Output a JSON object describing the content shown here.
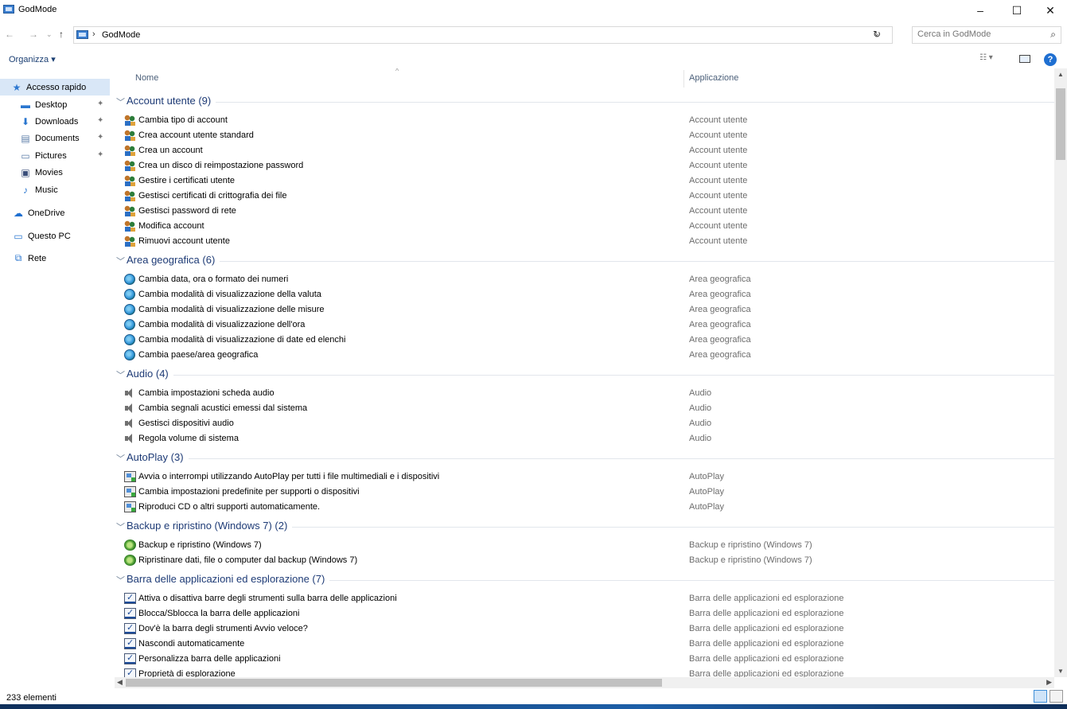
{
  "window": {
    "title": "GodMode",
    "controls": {
      "minimize": "–",
      "maximize": "☐",
      "close": "✕"
    }
  },
  "address": {
    "separator": "›",
    "crumb": "GodMode",
    "search_placeholder": "Cerca in GodMode"
  },
  "toolbar": {
    "organize_label": "Organizza ▾",
    "view_label": "☷ ▾",
    "help_label": "?"
  },
  "nav": {
    "items": [
      {
        "label": "Accesso rapido",
        "icon": "star-icon",
        "selected": true
      },
      {
        "label": "Desktop",
        "icon": "desktop-icon",
        "pinned": true
      },
      {
        "label": "Downloads",
        "icon": "download-icon",
        "pinned": true
      },
      {
        "label": "Documents",
        "icon": "document-icon",
        "pinned": true
      },
      {
        "label": "Pictures",
        "icon": "pictures-icon",
        "pinned": true
      },
      {
        "label": "Movies",
        "icon": "movies-icon"
      },
      {
        "label": "Music",
        "icon": "music-icon"
      },
      {
        "label": "OneDrive",
        "icon": "cloud-icon"
      },
      {
        "label": "Questo PC",
        "icon": "computer-icon"
      },
      {
        "label": "Rete",
        "icon": "network-icon"
      }
    ]
  },
  "columns": {
    "name": "Nome",
    "app": "Applicazione"
  },
  "groups": [
    {
      "title": "Account utente (9)",
      "app": "Account utente",
      "icon": "users",
      "items": [
        "Cambia tipo di account",
        "Crea account utente standard",
        "Crea un account",
        "Crea un disco di reimpostazione password",
        "Gestire i certificati utente",
        "Gestisci certificati di crittografia dei file",
        "Gestisci password di rete",
        "Modifica account",
        "Rimuovi account utente"
      ]
    },
    {
      "title": "Area geografica (6)",
      "app": "Area geografica",
      "icon": "globe",
      "items": [
        "Cambia data, ora o formato dei numeri",
        "Cambia modalità di visualizzazione della valuta",
        "Cambia modalità di visualizzazione delle misure",
        "Cambia modalità di visualizzazione dell'ora",
        "Cambia modalità di visualizzazione di date ed elenchi",
        "Cambia paese/area geografica"
      ]
    },
    {
      "title": "Audio (4)",
      "app": "Audio",
      "icon": "audio",
      "items": [
        "Cambia impostazioni scheda audio",
        "Cambia segnali acustici emessi dal sistema",
        "Gestisci dispositivi audio",
        "Regola volume di sistema"
      ]
    },
    {
      "title": "AutoPlay (3)",
      "app": "AutoPlay",
      "icon": "autoplay",
      "items": [
        "Avvia o interrompi utilizzando AutoPlay per tutti i file multimediali e i dispositivi",
        "Cambia impostazioni predefinite per supporti o dispositivi",
        "Riproduci CD o altri supporti automaticamente."
      ]
    },
    {
      "title": "Backup e ripristino (Windows 7) (2)",
      "app": "Backup e ripristino (Windows 7)",
      "icon": "backup",
      "items": [
        "Backup e ripristino (Windows 7)",
        "Ripristinare dati, file o computer dal backup (Windows 7)"
      ]
    },
    {
      "title": "Barra delle applicazioni ed esplorazione (7)",
      "app": "Barra delle applicazioni ed esplorazione",
      "icon": "taskbar",
      "items": [
        "Attiva o disattiva barre degli strumenti sulla barra delle applicazioni",
        "Blocca/Sblocca la barra delle applicazioni",
        "Dov'è la barra degli strumenti Avvio veloce?",
        "Nascondi automaticamente",
        "Personalizza barra delle applicazioni",
        "Proprietà di esplorazione"
      ]
    }
  ],
  "status": {
    "count": "233 elementi"
  }
}
